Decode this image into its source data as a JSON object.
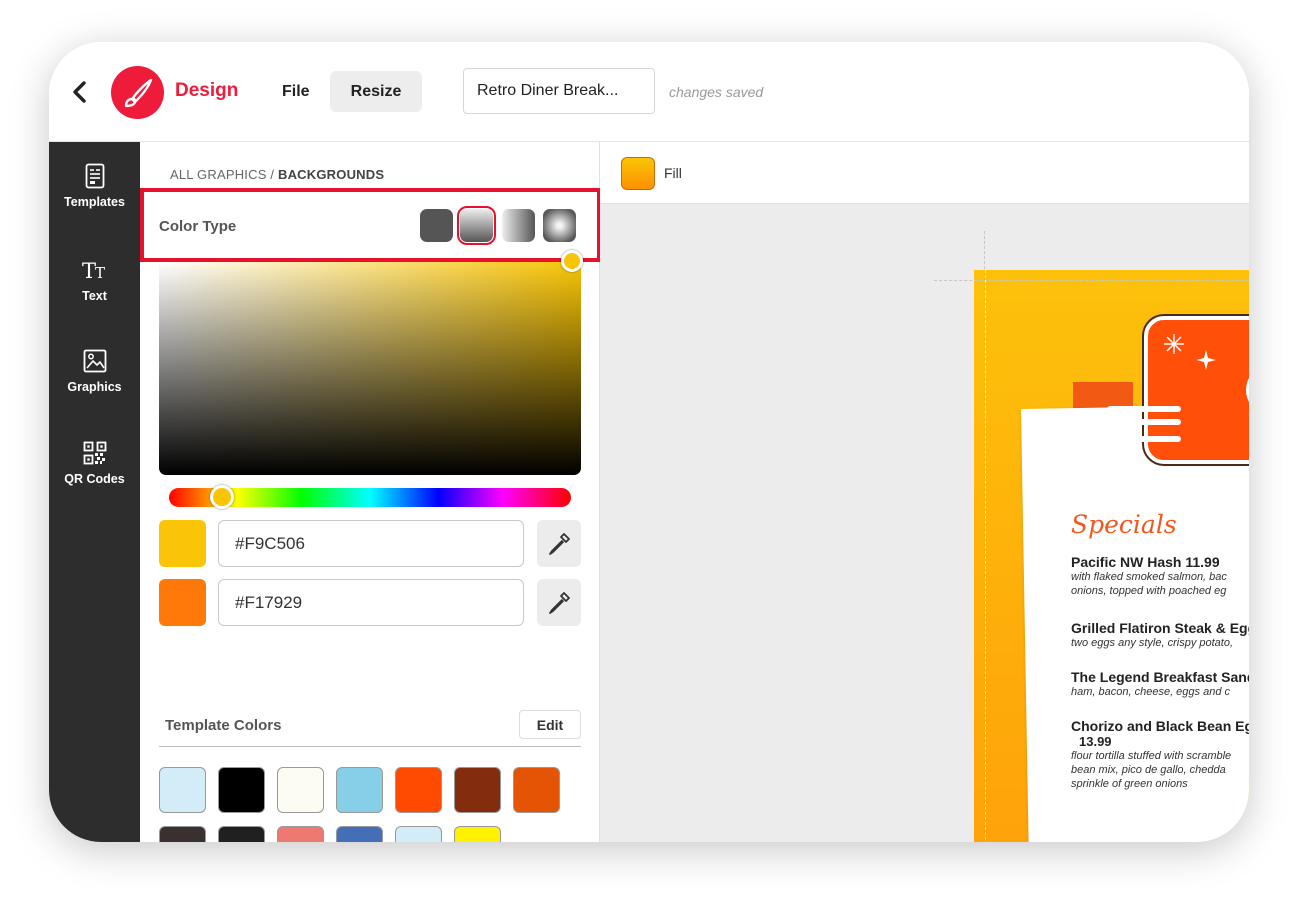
{
  "header": {
    "back_icon": "chevron-left-icon",
    "logo_icon": "paintbrush-icon",
    "app_title": "Design",
    "menu_file": "File",
    "menu_resize": "Resize",
    "document_title": "Retro Diner Break...",
    "save_status": "changes saved",
    "brand_color": "#EE1C3A"
  },
  "sidebar": {
    "items": [
      {
        "label": "Templates",
        "icon": "templates-icon"
      },
      {
        "label": "Text",
        "icon": "text-icon"
      },
      {
        "label": "Graphics",
        "icon": "image-icon"
      },
      {
        "label": "QR Codes",
        "icon": "qr-code-icon"
      }
    ]
  },
  "panel": {
    "breadcrumb_root": "ALL GRAPHICS",
    "breadcrumb_sep": " / ",
    "breadcrumb_current": "BACKGROUNDS",
    "color_type_label": "Color Type",
    "color_types": [
      "solid",
      "linear-vertical",
      "linear-horizontal",
      "radial"
    ],
    "selected_color_type": "linear-vertical",
    "color_stops": [
      {
        "hex": "#F9C506"
      },
      {
        "hex": "#F17929"
      }
    ],
    "template_colors_label": "Template Colors",
    "edit_label": "Edit",
    "template_colors": [
      "#D2ECF8",
      "#000000",
      "#FDFCF3",
      "#87CEE8",
      "#FF4A00",
      "#842C0E",
      "#E45404",
      "#3A3030",
      "#202020",
      "#EE7872",
      "#446FB8",
      "#D2ECF8",
      "#FFF200"
    ]
  },
  "canvas": {
    "fill_label": "Fill",
    "fill_color": "#FF9000",
    "menu": {
      "heading": "Specials",
      "items": [
        {
          "name": "Pacific NW Hash   11.99",
          "desc": [
            "with flaked smoked salmon, bac",
            "onions, topped with poached eg"
          ]
        },
        {
          "name": "Grilled Flatiron Steak & Egg",
          "desc": [
            "two eggs any style, crispy potato,"
          ]
        },
        {
          "name": "The Legend Breakfast Sand",
          "desc": [
            "ham, bacon, cheese, eggs and c"
          ]
        },
        {
          "name": "Chorizo and Black Bean Eg",
          "price": "13.99",
          "desc": [
            "flour tortilla stuffed with scramble",
            "bean mix, pico de gallo, chedda",
            "sprinkle of green onions"
          ]
        }
      ]
    }
  }
}
